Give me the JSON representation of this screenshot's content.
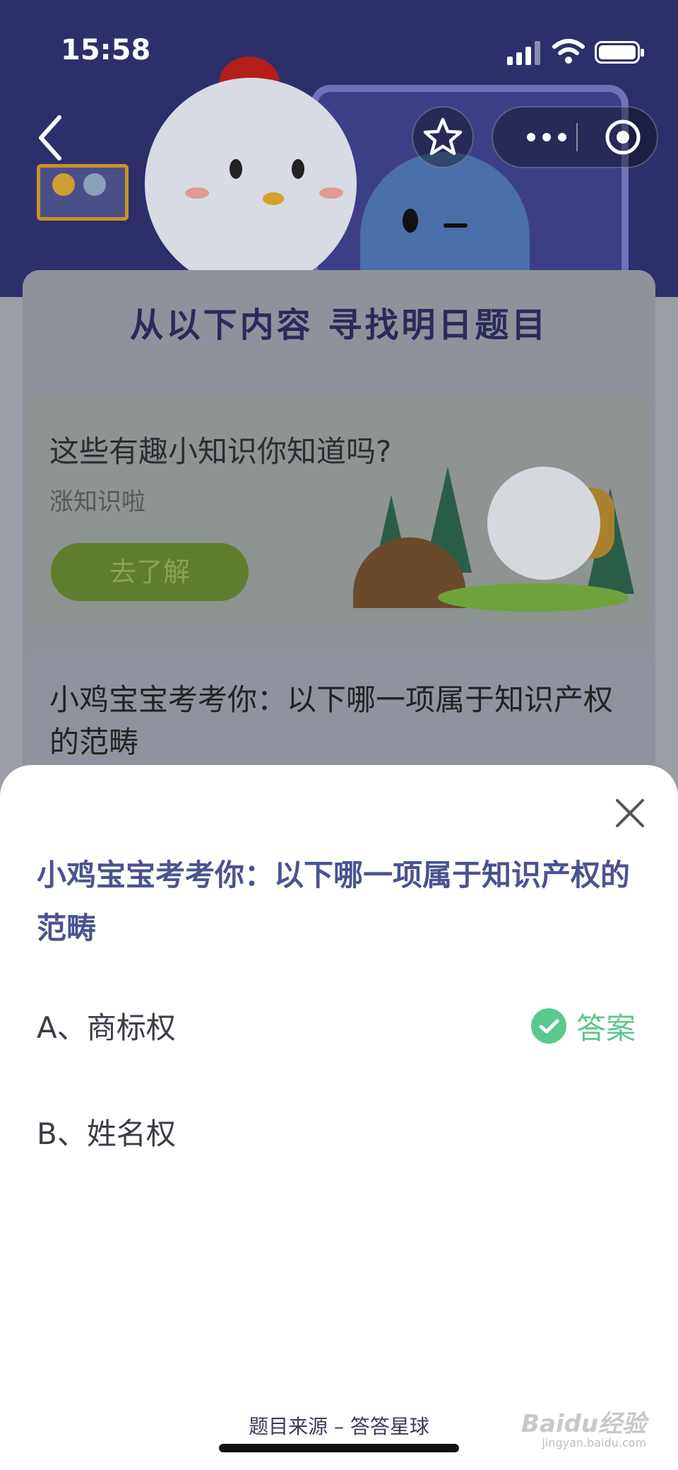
{
  "status_bar": {
    "time": "15:58"
  },
  "background_page": {
    "section_title": "从以下内容 寻找明日题目",
    "feature_card": {
      "title": "这些有趣小知识你知道吗?",
      "subtitle": "涨知识啦",
      "button_label": "去了解"
    },
    "quiz_card": {
      "text": "小鸡宝宝考考你：以下哪一项属于知识产权的范畴"
    }
  },
  "nav": {
    "back_icon": "chevron-left-icon",
    "favorite_icon": "star-icon",
    "more_icon": "ellipsis-icon",
    "close_miniprogram_icon": "target-icon"
  },
  "sheet": {
    "question": "小鸡宝宝考考你：以下哪一项属于知识产权的范畴",
    "options": [
      {
        "label": "A、商标权",
        "is_answer": true
      },
      {
        "label": "B、姓名权",
        "is_answer": false
      }
    ],
    "answer_label": "答案",
    "source": "题目来源 – 答答星球"
  },
  "colors": {
    "question_text": "#4a5390",
    "answer_green": "#5cc88d",
    "hero_background": "#2d2f6b"
  },
  "watermark": {
    "brand": "Baidu经验",
    "domain": "jingyan.baidu.com"
  }
}
